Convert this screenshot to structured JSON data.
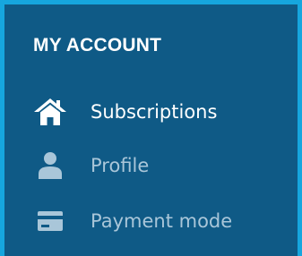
{
  "account_menu": {
    "title": "MY ACCOUNT",
    "items": [
      {
        "label": "Subscriptions",
        "icon": "home-icon",
        "active": true
      },
      {
        "label": "Profile",
        "icon": "user-icon",
        "active": false
      },
      {
        "label": "Payment mode",
        "icon": "credit-card-icon",
        "active": false
      }
    ]
  },
  "colors": {
    "panel_background": "#0f5a86",
    "panel_border": "#16a6de",
    "text": "#ffffff",
    "dim_text": "#a9c6d9"
  }
}
